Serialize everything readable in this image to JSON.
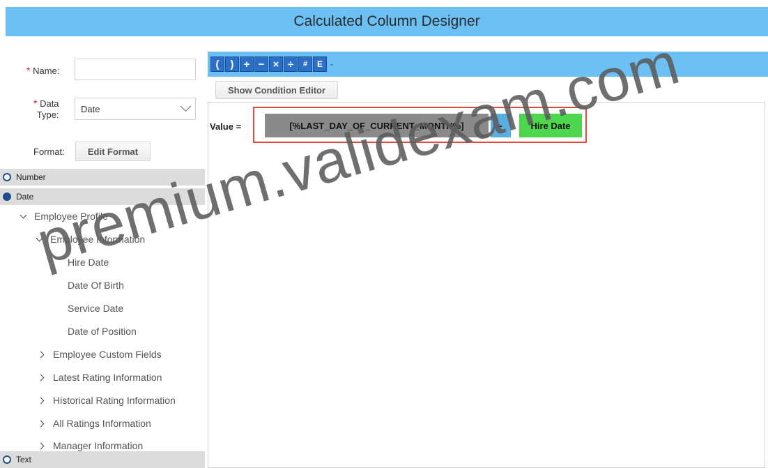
{
  "window": {
    "title": "Calculated Column Designer"
  },
  "form": {
    "required_mark": "*",
    "name_label": "Name:",
    "name_value": "",
    "data_type_label_1": "Data",
    "data_type_label_2": "Type:",
    "data_type_value": "Date",
    "format_label": "Format:",
    "edit_format_label": "Edit Format"
  },
  "tree": {
    "categories": {
      "number": "Number",
      "date": "Date",
      "text": "Text"
    },
    "nodes": {
      "employee_profile": "Employee Profile",
      "employee_information": "Employee Information",
      "hire_date": "Hire Date",
      "date_of_birth": "Date Of Birth",
      "service_date": "Service Date",
      "date_of_position": "Date of Position",
      "employee_custom_fields": "Employee Custom Fields",
      "latest_rating_information": "Latest Rating Information",
      "historical_rating_information": "Historical Rating Information",
      "all_ratings_information": "All Ratings Information",
      "manager_information": "Manager Information"
    }
  },
  "toolbar": {
    "buttons": [
      "(",
      ")",
      "+",
      "−",
      "×",
      "÷",
      "#",
      "E"
    ],
    "trailing": "-",
    "show_condition_editor_label": "Show Condition Editor"
  },
  "expression": {
    "value_label": "Value =",
    "token_variable": "[%LAST_DAY_OF_CURRENT_MONTH%]",
    "token_operator": "-",
    "token_field": "Hire Date"
  },
  "watermark": {
    "text": "premium.validexam.com"
  },
  "colors": {
    "title_bar": "#6cc0f3",
    "toolbar_button": "#2b6fc7",
    "variable_token": "#8a8a8a",
    "operator_token": "#5aaee0",
    "field_token": "#4fd64f",
    "highlight_border": "#e04a3a",
    "required_mark": "#e0201b"
  }
}
